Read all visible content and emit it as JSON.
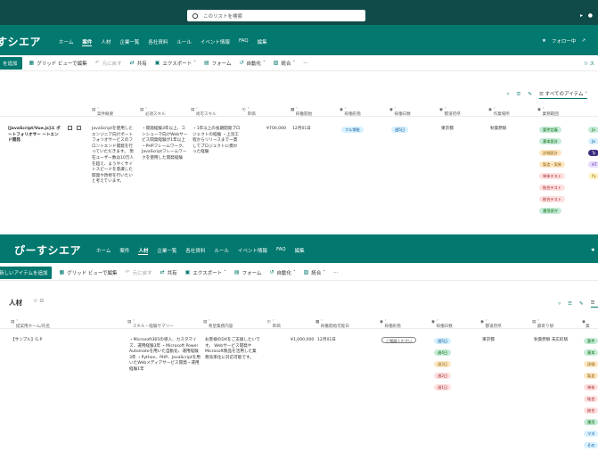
{
  "top": {
    "search_placeholder": "このリストを検索",
    "site_title": "すシエア",
    "nav": [
      "ホーム",
      "案件",
      "人材",
      "企業一覧",
      "各社資料",
      "ルール",
      "イベント情報",
      "FAQ",
      "編集"
    ],
    "nav_active": 1,
    "follow": "フォロー中",
    "commands": {
      "new": "を追加",
      "grid": "グリッド ビューで編集",
      "undo": "元に戻す",
      "share": "共有",
      "export": "エクスポート",
      "form": "フォーム",
      "automate": "自動化",
      "integrate": "統合",
      "more": "···"
    },
    "view_name": "すべてのアイテム",
    "columns": [
      "案件概要",
      "必須スキル",
      "尚可スキル",
      "単価",
      "稼働開始",
      "稼働形態",
      "稼働日数",
      "都道府県",
      "作業場所",
      "業務範囲"
    ],
    "row": {
      "title": "[JavaScript/Vue.js]エ ポートフォリオサー ートエンド開発",
      "summary": "JavaScriptを使用したエンジニア向けポートフォリオサービスのフロントエンド開発を行っていただきます。 現在ユーザー数は10万人を超え、ようやくサイトスピードを意識した開発や改修を行いたいと考えています。",
      "required": "・開発経験3年以上、コンシューマ向けWebサービス開発経験が1年以上 ・PHPフレームワーク、JavaScriptフレームワークを使用した開発経験",
      "preferred": "・1年以上の長期開発プロジェクトの経験 ・上流工程からリリースまで一貫してプロジェクトに携わった経験",
      "price": "¥700,000",
      "start": "12月01日",
      "style": "フル常駐",
      "days": "週5日",
      "prefecture": "東京都",
      "place": "秋葉原駅",
      "scopes": [
        "要件定義",
        "基本設計",
        "詳細設計",
        "製造・実装",
        "単体テスト",
        "結合テスト",
        "総合テスト",
        "運用保守"
      ],
      "extra_tags": [
        "Ja",
        "Ja",
        "Ty",
        "HT",
        "Py"
      ]
    }
  },
  "bottom": {
    "site_title": "ぴーすシエア",
    "nav": [
      "ホーム",
      "案件",
      "人材",
      "企業一覧",
      "各社資料",
      "ルール",
      "イベント情報",
      "FAQ",
      "編集"
    ],
    "nav_active": 2,
    "commands": {
      "new": "新しいアイテムを追加",
      "grid": "グリッド ビューで編集",
      "undo": "元に戻す",
      "share": "共有",
      "export": "エクスポート",
      "form": "フォーム",
      "automate": "自動化",
      "integrate": "統合",
      "more": "···"
    },
    "list_title": "人材",
    "columns": [
      "提案用ネーム/氏名",
      "スキル・経験サマリー",
      "希望業務内容",
      "単価",
      "稼働開始可能日",
      "稼働形態",
      "稼働日数",
      "都道府県",
      "最寄り駅",
      "業"
    ],
    "row": {
      "name": "【サンプル】G.P",
      "skills": "・Microsoft365の導入、カスタマイズ、運用経験3年 ・Microsoft Power Automateを用いた自動化、運用経験3年 ・Python、PHP、JavaScriptを用いたWebメディアサービス開発・運用経験1年",
      "wish": "お客様のDXをご支援したいです。 Webサービス開発やMicrosoft製品を活用した業務効率化に対応可能です。",
      "price": "¥1,000,000",
      "start": "12月01日",
      "style": "ご相談ください",
      "days": [
        "週5日",
        "週4日",
        "週3日",
        "週2日",
        "週1日"
      ],
      "prefecture": "東京都",
      "station": "秋葉原駅 末広町駅",
      "tags": [
        "要件",
        "基本",
        "詳細",
        "製造",
        "単体",
        "結合",
        "総合",
        "運用",
        "マネ",
        "その"
      ]
    }
  },
  "colors": {
    "dark": "#114b49",
    "brand": "#02786e",
    "white": "#ffffff"
  }
}
